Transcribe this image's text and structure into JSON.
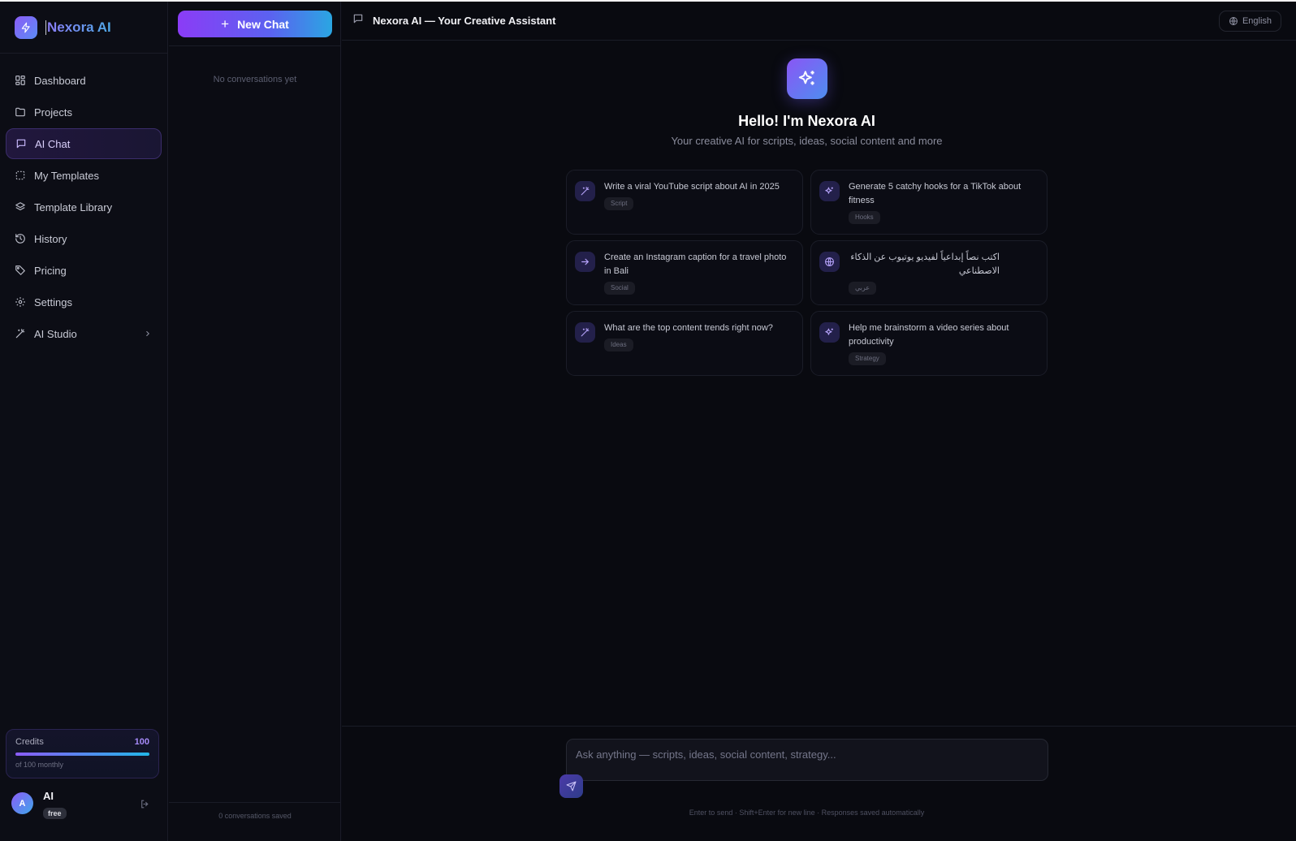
{
  "brand": {
    "name": "Nexora AI"
  },
  "sidebar": {
    "items": [
      {
        "label": "Dashboard",
        "icon": "dashboard-icon"
      },
      {
        "label": "Projects",
        "icon": "folder-icon"
      },
      {
        "label": "AI Chat",
        "icon": "chat-icon",
        "active": true
      },
      {
        "label": "My Templates",
        "icon": "templates-icon"
      },
      {
        "label": "Template Library",
        "icon": "layers-icon"
      },
      {
        "label": "History",
        "icon": "history-icon"
      },
      {
        "label": "Pricing",
        "icon": "tag-icon"
      },
      {
        "label": "Settings",
        "icon": "gear-icon"
      },
      {
        "label": "AI Studio",
        "icon": "wand-icon",
        "expandable": true
      }
    ],
    "credits": {
      "label": "Credits",
      "value": "100",
      "caption": "of 100 monthly",
      "fill": 1.0
    },
    "user": {
      "initial": "A",
      "name": "AI",
      "plan": "free"
    }
  },
  "conversations": {
    "new_chat_label": "New Chat",
    "empty_text": "No conversations yet",
    "footer": "0 conversations saved"
  },
  "header": {
    "title": "Nexora AI — Your Creative Assistant",
    "language": "English"
  },
  "hero": {
    "title": "Hello! I'm Nexora AI",
    "subtitle": "Your creative AI for scripts, ideas, social content and more"
  },
  "suggestions": [
    {
      "text": "Write a viral YouTube script about AI in 2025",
      "tag": "Script",
      "icon": "wand-icon"
    },
    {
      "text": "Generate 5 catchy hooks for a TikTok about fitness",
      "tag": "Hooks",
      "icon": "sparkles-icon"
    },
    {
      "text": "Create an Instagram caption for a travel photo in Bali",
      "tag": "Social",
      "icon": "arrow-right-icon"
    },
    {
      "text": "اكتب نصاً إبداعياً لفيديو يوتيوب عن الذكاء الاصطناعي",
      "tag": "عربي",
      "icon": "globe-icon"
    },
    {
      "text": "What are the top content trends right now?",
      "tag": "Ideas",
      "icon": "wand-icon"
    },
    {
      "text": "Help me brainstorm a video series about productivity",
      "tag": "Strategy",
      "icon": "sparkles-icon"
    }
  ],
  "composer": {
    "placeholder": "Ask anything — scripts, ideas, social content, strategy...",
    "value": "",
    "hint": "Enter to send · Shift+Enter for new line · Responses saved automatically"
  },
  "colors": {
    "accent_purple": "#8b5cf6",
    "accent_blue": "#22b6e8",
    "background": "#0a0b12"
  }
}
